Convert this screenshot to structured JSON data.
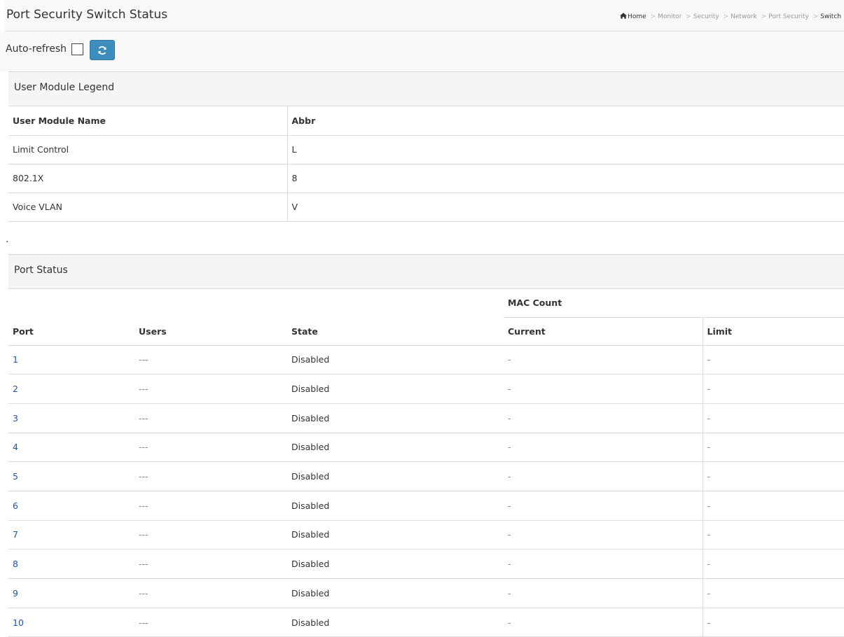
{
  "header": {
    "title": "Port Security Switch Status",
    "breadcrumb": [
      "Home",
      "Monitor",
      "Security",
      "Network",
      "Port Security",
      "Switch"
    ],
    "separator": ">"
  },
  "refresh": {
    "label": "Auto-refresh",
    "checked": false,
    "button_icon": "refresh-icon"
  },
  "legend": {
    "heading": "User Module Legend",
    "columns": [
      "User Module Name",
      "Abbr"
    ],
    "rows": [
      [
        "Limit Control",
        "L"
      ],
      [
        "802.1X",
        "8"
      ],
      [
        "Voice VLAN",
        "V"
      ]
    ]
  },
  "separator_dot": ".",
  "port_status": {
    "heading": "Port Status",
    "group_header": "MAC Count",
    "columns": [
      "Port",
      "Users",
      "State",
      "Current",
      "Limit"
    ],
    "rows": [
      [
        "1",
        "---",
        "Disabled",
        "-",
        "-"
      ],
      [
        "2",
        "---",
        "Disabled",
        "-",
        "-"
      ],
      [
        "3",
        "---",
        "Disabled",
        "-",
        "-"
      ],
      [
        "4",
        "---",
        "Disabled",
        "-",
        "-"
      ],
      [
        "5",
        "---",
        "Disabled",
        "-",
        "-"
      ],
      [
        "6",
        "---",
        "Disabled",
        "-",
        "-"
      ],
      [
        "7",
        "---",
        "Disabled",
        "-",
        "-"
      ],
      [
        "8",
        "---",
        "Disabled",
        "-",
        "-"
      ],
      [
        "9",
        "---",
        "Disabled",
        "-",
        "-"
      ],
      [
        "10",
        "---",
        "Disabled",
        "-",
        "-"
      ]
    ]
  },
  "colors": {
    "accent": "#3c8dbc",
    "link": "#2255aa",
    "panel_bg": "#f5f5f5"
  }
}
